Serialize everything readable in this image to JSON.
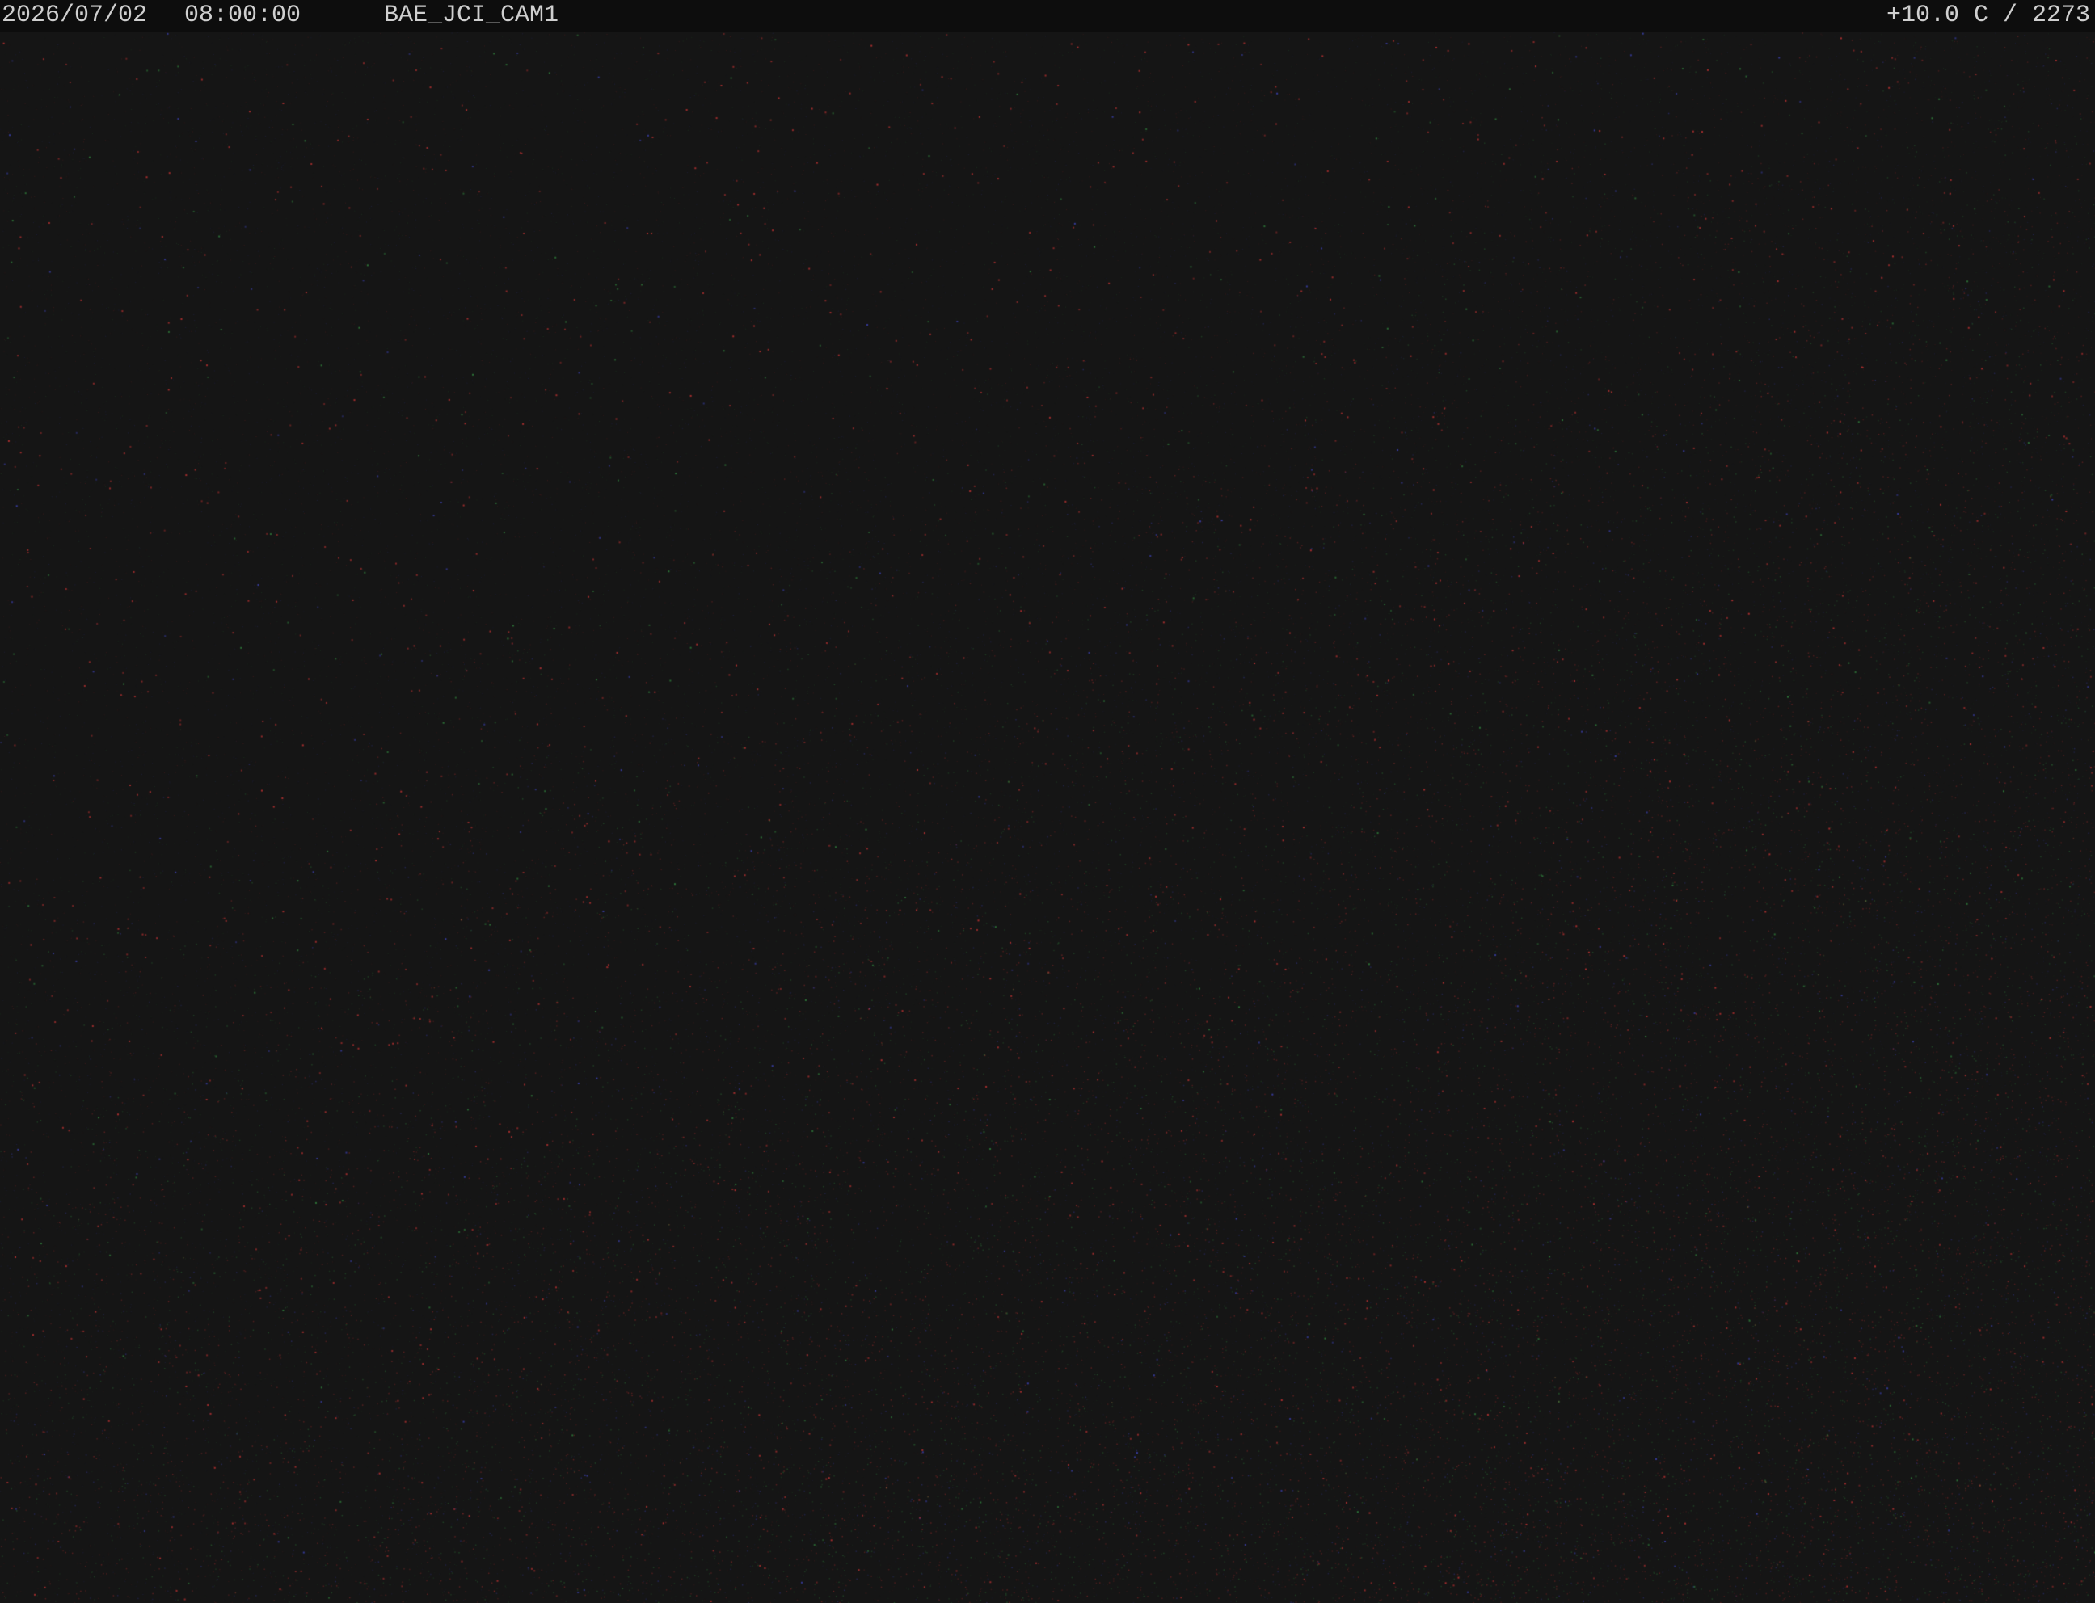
{
  "overlay": {
    "date": "2026/07/02",
    "time": "08:00:00",
    "camera_id": "BAE_JCI_CAM1",
    "temperature_readout": "+10.0 C / 2273"
  },
  "colors": {
    "background": "#151515",
    "overlay_bar": "#0d0d0d",
    "overlay_text": "#cfcfcf",
    "noise_red": "#b03030",
    "noise_green": "#2f7a3a",
    "noise_blue": "#3a3fa8"
  }
}
